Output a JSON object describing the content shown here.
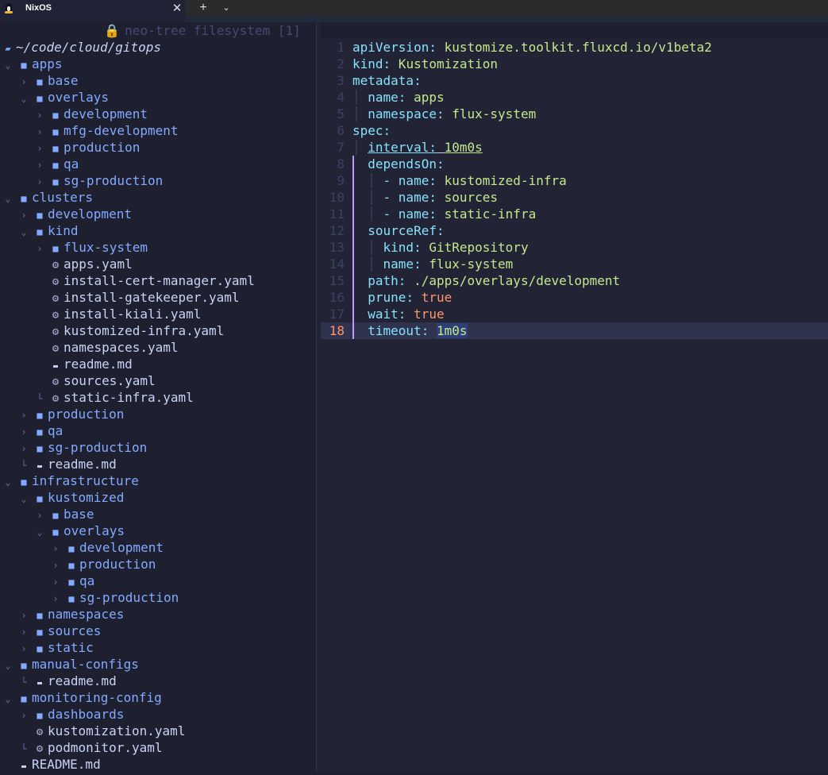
{
  "window": {
    "tab_title": "NixOS",
    "close_glyph": "✕",
    "new_tab_glyph": "+",
    "dropdown_glyph": "⌄"
  },
  "sidebar": {
    "winbar_title": "neo-tree filesystem [1]",
    "root_path": "~/code/cloud/gitops",
    "tree": [
      {
        "depth": 0,
        "type": "dir",
        "open": true,
        "name": "apps"
      },
      {
        "depth": 1,
        "type": "dir",
        "open": false,
        "name": "base"
      },
      {
        "depth": 1,
        "type": "dir",
        "open": true,
        "name": "overlays"
      },
      {
        "depth": 2,
        "type": "dir",
        "open": false,
        "name": "development"
      },
      {
        "depth": 2,
        "type": "dir",
        "open": false,
        "name": "mfg-development"
      },
      {
        "depth": 2,
        "type": "dir",
        "open": false,
        "name": "production"
      },
      {
        "depth": 2,
        "type": "dir",
        "open": false,
        "name": "qa"
      },
      {
        "depth": 2,
        "type": "dir",
        "open": false,
        "name": "sg-production"
      },
      {
        "depth": 0,
        "type": "dir",
        "open": true,
        "name": "clusters"
      },
      {
        "depth": 1,
        "type": "dir",
        "open": false,
        "name": "development"
      },
      {
        "depth": 1,
        "type": "dir",
        "open": true,
        "name": "kind"
      },
      {
        "depth": 2,
        "type": "dir",
        "open": false,
        "name": "flux-system"
      },
      {
        "depth": 2,
        "type": "yaml",
        "name": "apps.yaml"
      },
      {
        "depth": 2,
        "type": "yaml",
        "name": "install-cert-manager.yaml"
      },
      {
        "depth": 2,
        "type": "yaml",
        "name": "install-gatekeeper.yaml"
      },
      {
        "depth": 2,
        "type": "yaml",
        "name": "install-kiali.yaml"
      },
      {
        "depth": 2,
        "type": "yaml",
        "name": "kustomized-infra.yaml"
      },
      {
        "depth": 2,
        "type": "yaml",
        "name": "namespaces.yaml"
      },
      {
        "depth": 2,
        "type": "md",
        "name": "readme.md"
      },
      {
        "depth": 2,
        "type": "yaml",
        "name": "sources.yaml"
      },
      {
        "depth": 2,
        "type": "yaml",
        "name": "static-infra.yaml",
        "last": true
      },
      {
        "depth": 1,
        "type": "dir",
        "open": false,
        "name": "production"
      },
      {
        "depth": 1,
        "type": "dir",
        "open": false,
        "name": "qa"
      },
      {
        "depth": 1,
        "type": "dir",
        "open": false,
        "name": "sg-production"
      },
      {
        "depth": 1,
        "type": "md",
        "name": "readme.md",
        "last": true
      },
      {
        "depth": 0,
        "type": "dir",
        "open": true,
        "name": "infrastructure"
      },
      {
        "depth": 1,
        "type": "dir",
        "open": true,
        "name": "kustomized"
      },
      {
        "depth": 2,
        "type": "dir",
        "open": false,
        "name": "base"
      },
      {
        "depth": 2,
        "type": "dir",
        "open": true,
        "name": "overlays"
      },
      {
        "depth": 3,
        "type": "dir",
        "open": false,
        "name": "development"
      },
      {
        "depth": 3,
        "type": "dir",
        "open": false,
        "name": "production"
      },
      {
        "depth": 3,
        "type": "dir",
        "open": false,
        "name": "qa"
      },
      {
        "depth": 3,
        "type": "dir",
        "open": false,
        "name": "sg-production"
      },
      {
        "depth": 1,
        "type": "dir",
        "open": false,
        "name": "namespaces"
      },
      {
        "depth": 1,
        "type": "dir",
        "open": false,
        "name": "sources"
      },
      {
        "depth": 1,
        "type": "dir",
        "open": false,
        "name": "static"
      },
      {
        "depth": 0,
        "type": "dir",
        "open": true,
        "name": "manual-configs"
      },
      {
        "depth": 1,
        "type": "md",
        "name": "readme.md",
        "last": true
      },
      {
        "depth": 0,
        "type": "dir",
        "open": true,
        "name": "monitoring-config"
      },
      {
        "depth": 1,
        "type": "dir",
        "open": false,
        "name": "dashboards"
      },
      {
        "depth": 1,
        "type": "yaml",
        "name": "kustomization.yaml"
      },
      {
        "depth": 1,
        "type": "yaml",
        "name": "podmonitor.yaml",
        "last": true
      },
      {
        "depth": 0,
        "type": "md",
        "name": "README.md"
      }
    ]
  },
  "editor": {
    "current_line": 18,
    "lines": [
      {
        "n": 1,
        "indent": 0,
        "key": "apiVersion",
        "value": "kustomize.toolkit.fluxcd.io/v1beta2",
        "vtype": "str"
      },
      {
        "n": 2,
        "indent": 0,
        "key": "kind",
        "value": "Kustomization",
        "vtype": "str"
      },
      {
        "n": 3,
        "indent": 0,
        "key": "metadata",
        "value": "",
        "vtype": "none"
      },
      {
        "n": 4,
        "indent": 1,
        "key": "name",
        "value": "apps",
        "vtype": "str"
      },
      {
        "n": 5,
        "indent": 1,
        "key": "namespace",
        "value": "flux-system",
        "vtype": "str"
      },
      {
        "n": 6,
        "indent": 0,
        "key": "spec",
        "value": "",
        "vtype": "none"
      },
      {
        "n": 7,
        "indent": 1,
        "key": "interval",
        "value": "10m0s",
        "vtype": "str",
        "underline": true
      },
      {
        "n": 8,
        "indent": 1,
        "key": "dependsOn",
        "value": "",
        "vtype": "none"
      },
      {
        "n": 9,
        "indent": 2,
        "dash": true,
        "key": "name",
        "value": "kustomized-infra",
        "vtype": "str"
      },
      {
        "n": 10,
        "indent": 2,
        "dash": true,
        "key": "name",
        "value": "sources",
        "vtype": "str"
      },
      {
        "n": 11,
        "indent": 2,
        "dash": true,
        "key": "name",
        "value": "static-infra",
        "vtype": "str"
      },
      {
        "n": 12,
        "indent": 1,
        "key": "sourceRef",
        "value": "",
        "vtype": "none"
      },
      {
        "n": 13,
        "indent": 2,
        "key": "kind",
        "value": "GitRepository",
        "vtype": "str"
      },
      {
        "n": 14,
        "indent": 2,
        "key": "name",
        "value": "flux-system",
        "vtype": "str"
      },
      {
        "n": 15,
        "indent": 1,
        "key": "path",
        "value": "./apps/overlays/development",
        "vtype": "str"
      },
      {
        "n": 16,
        "indent": 1,
        "key": "prune",
        "value": "true",
        "vtype": "bool"
      },
      {
        "n": 17,
        "indent": 1,
        "key": "wait",
        "value": "true",
        "vtype": "bool"
      },
      {
        "n": 18,
        "indent": 1,
        "key": "timeout",
        "value": "1m0s",
        "vtype": "str",
        "highlight": true
      }
    ]
  }
}
